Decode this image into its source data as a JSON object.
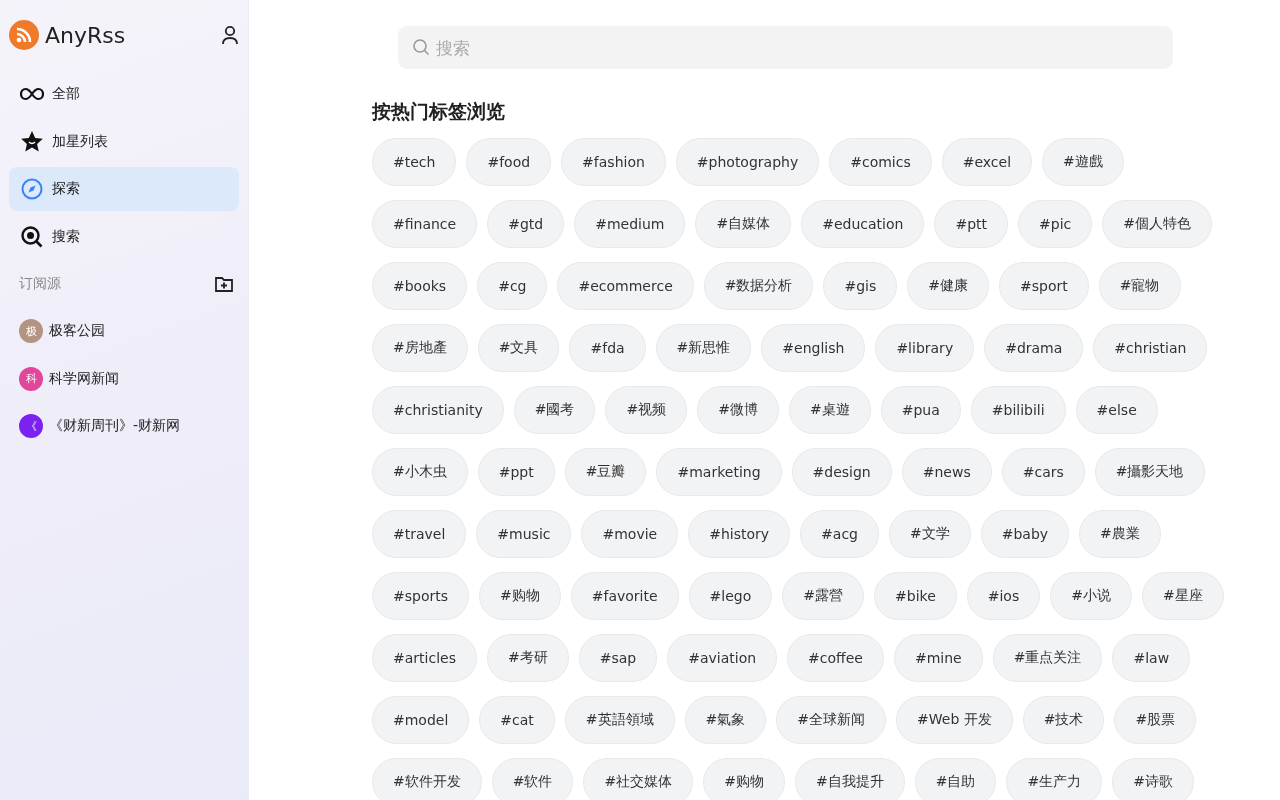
{
  "app": {
    "name": "AnyRss"
  },
  "nav": [
    {
      "label": "全部",
      "selected": false
    },
    {
      "label": "加星列表",
      "selected": false
    },
    {
      "label": "探索",
      "selected": true
    },
    {
      "label": "搜索",
      "selected": false
    }
  ],
  "feeds_section": {
    "title": "订阅源"
  },
  "feeds": [
    {
      "avatar": "极",
      "name": "极客公园",
      "color": "#b39483"
    },
    {
      "avatar": "科",
      "name": "科学网新闻",
      "color": "#e0479a"
    },
    {
      "avatar": "《",
      "name": "《财新周刊》-财新网",
      "color": "#7c22f0"
    }
  ],
  "search": {
    "placeholder": "搜索"
  },
  "tags_heading": "按热门标签浏览",
  "tag_rows": [
    [
      "#tech",
      "#food",
      "#fashion",
      "#photography",
      "#comics",
      "#excel",
      "#遊戲"
    ],
    [
      "#finance",
      "#gtd",
      "#medium",
      "#自媒体",
      "#education",
      "#ptt",
      "#pic",
      "#個人特色"
    ],
    [
      "#books",
      "#cg",
      "#ecommerce",
      "#数据分析",
      "#gis",
      "#健康",
      "#sport",
      "#寵物"
    ],
    [
      "#房地產",
      "#文具",
      "#fda",
      "#新思惟",
      "#english",
      "#library",
      "#drama",
      "#christian"
    ],
    [
      "#christianity",
      "#國考",
      "#视频",
      "#微博",
      "#桌遊",
      "#pua",
      "#bilibili",
      "#else"
    ],
    [
      "#小木虫",
      "#ppt",
      "#豆瓣",
      "#marketing",
      "#design",
      "#news",
      "#cars",
      "#攝影天地"
    ],
    [
      "#travel",
      "#music",
      "#movie",
      "#history",
      "#acg",
      "#文学",
      "#baby",
      "#農業"
    ],
    [
      "#sports",
      "#购物",
      "#favorite",
      "#lego",
      "#露營",
      "#bike",
      "#ios",
      "#小说",
      "#星座"
    ],
    [
      "#articles",
      "#考研",
      "#sap",
      "#aviation",
      "#coffee",
      "#mine",
      "#重点关注",
      "#law"
    ],
    [
      "#model",
      "#cat",
      "#英語領域",
      "#氣象",
      "#全球新闻",
      "#Web 开发",
      "#技术",
      "#股票"
    ],
    [
      "#软件开发",
      "#软件",
      "#社交媒体",
      "#购物",
      "#自我提升",
      "#自助",
      "#生产力",
      "#诗歌"
    ]
  ]
}
